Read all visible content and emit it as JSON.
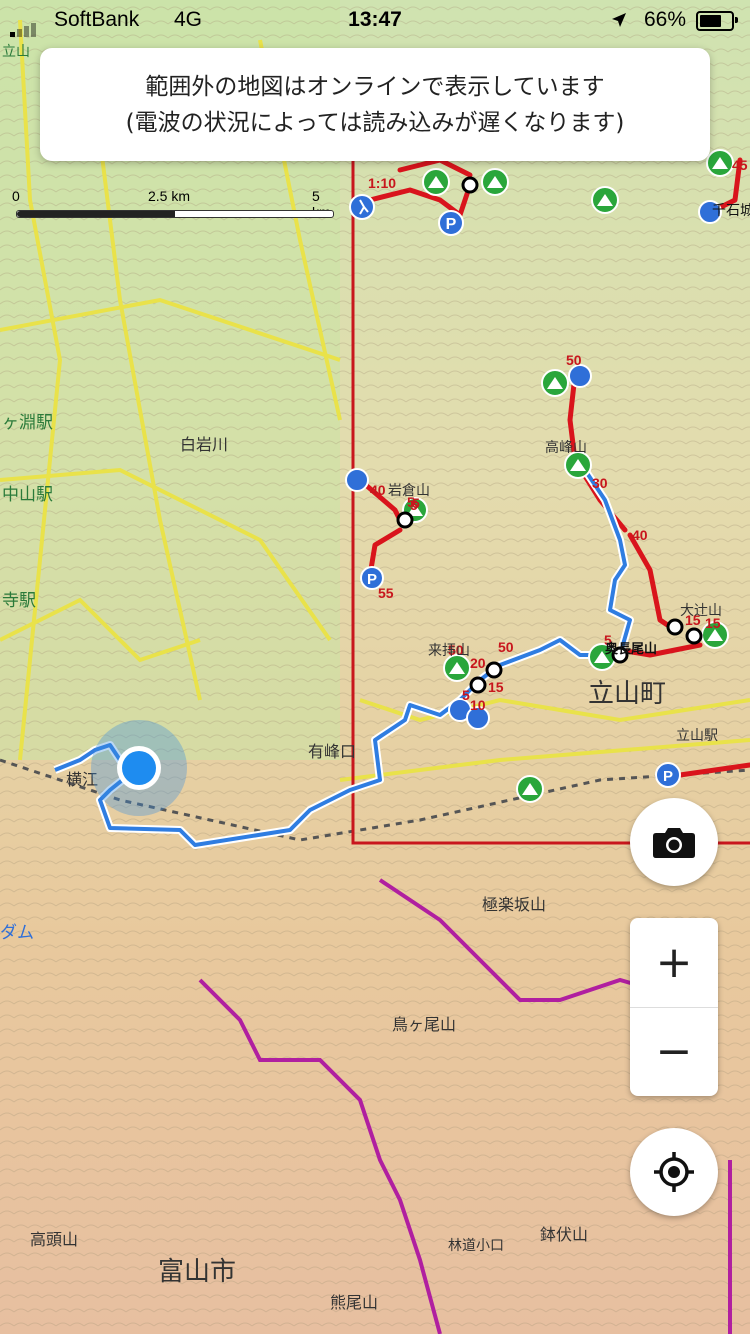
{
  "status_bar": {
    "carrier": "SoftBank",
    "network": "4G",
    "time": "13:47",
    "battery": "66%"
  },
  "toast": {
    "line1": "範囲外の地図はオンラインで表示しています",
    "line2": "(電波の状況によっては読み込みが遅くなります)"
  },
  "scale_bar": {
    "left": "0",
    "mid": "2.5 km",
    "right": "5 km"
  },
  "map_labels": {
    "town_tateyama": "立山町",
    "city_toyama": "富山市",
    "okunagao": "奥長尾山",
    "gokurakuzaka": "極楽坂山",
    "torigao": "鳥ヶ尾山",
    "hachibuse": "鉢伏山",
    "takazumi": "高頭山",
    "kumao": "熊尾山",
    "shiroiwa_river": "白岩川",
    "arimine": "有峰口",
    "iwakura": "岩倉山",
    "kuruma": "来拝山",
    "takase": "高峰山",
    "odaira": "大辻山",
    "senjo": "千石城",
    "nakayama_st": "中山駅",
    "kabuchi_st": "ヶ淵駅",
    "jiji_st": "寺駅",
    "tateyama_label": "立山",
    "yokoe": "横江",
    "dam": "ダム",
    "rindou": "林道小口",
    "right_edge": "立山駅"
  },
  "route_labels": [
    "1:10",
    "5",
    "40",
    "5",
    "55",
    "50",
    "30",
    "40",
    "15",
    "15",
    "5",
    "50",
    "20",
    "5",
    "10",
    "15",
    "5",
    "45",
    "50"
  ],
  "colors": {
    "route_red": "#d9141c",
    "track_blue": "#2f7de1",
    "location_blue": "#1e8cf0",
    "border_red": "#c8161d",
    "pref_border": "#b01fa0"
  },
  "controls": {
    "zoom_in": "+",
    "zoom_out": "−"
  },
  "icons": [
    "camera-icon",
    "zoom-in-icon",
    "zoom-out-icon",
    "locate-icon",
    "location-arrow-icon",
    "hiker-icon",
    "parking-icon",
    "mountain-icon"
  ]
}
